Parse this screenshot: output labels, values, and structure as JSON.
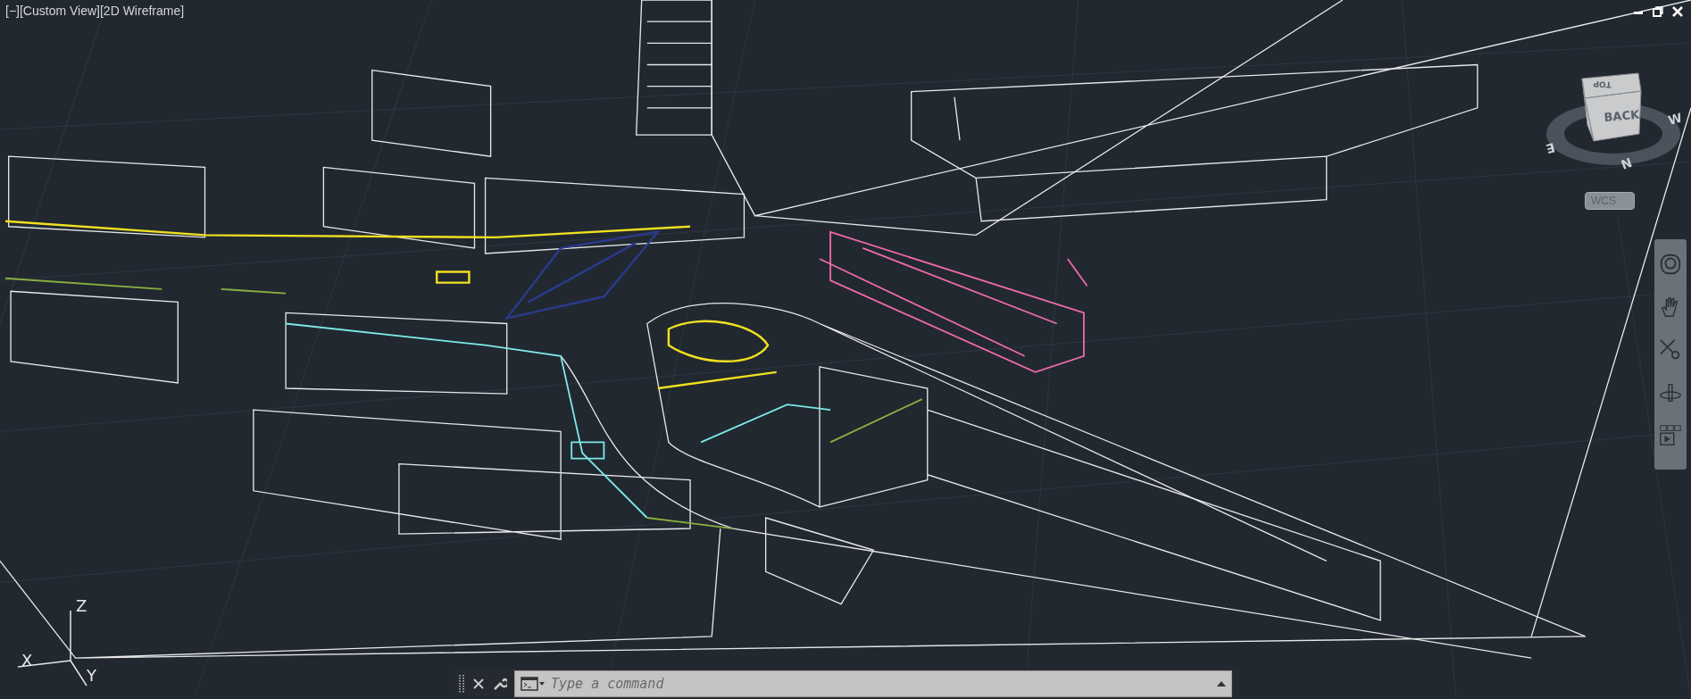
{
  "viewport": {
    "controls": [
      {
        "label": "[−]"
      },
      {
        "label": "[Custom View]"
      },
      {
        "label": "[2D Wireframe]"
      }
    ]
  },
  "viewcube": {
    "top_face": "TOP",
    "front_face": "BACK",
    "compass": [
      {
        "label": "W"
      },
      {
        "label": "E"
      },
      {
        "label": "N"
      }
    ]
  },
  "ucs_menu": {
    "label": "WCS"
  },
  "ucs_icon": {
    "z_label": "Z",
    "x_label": "X",
    "y_label": "Y"
  },
  "command_line": {
    "placeholder": "Type a command"
  }
}
